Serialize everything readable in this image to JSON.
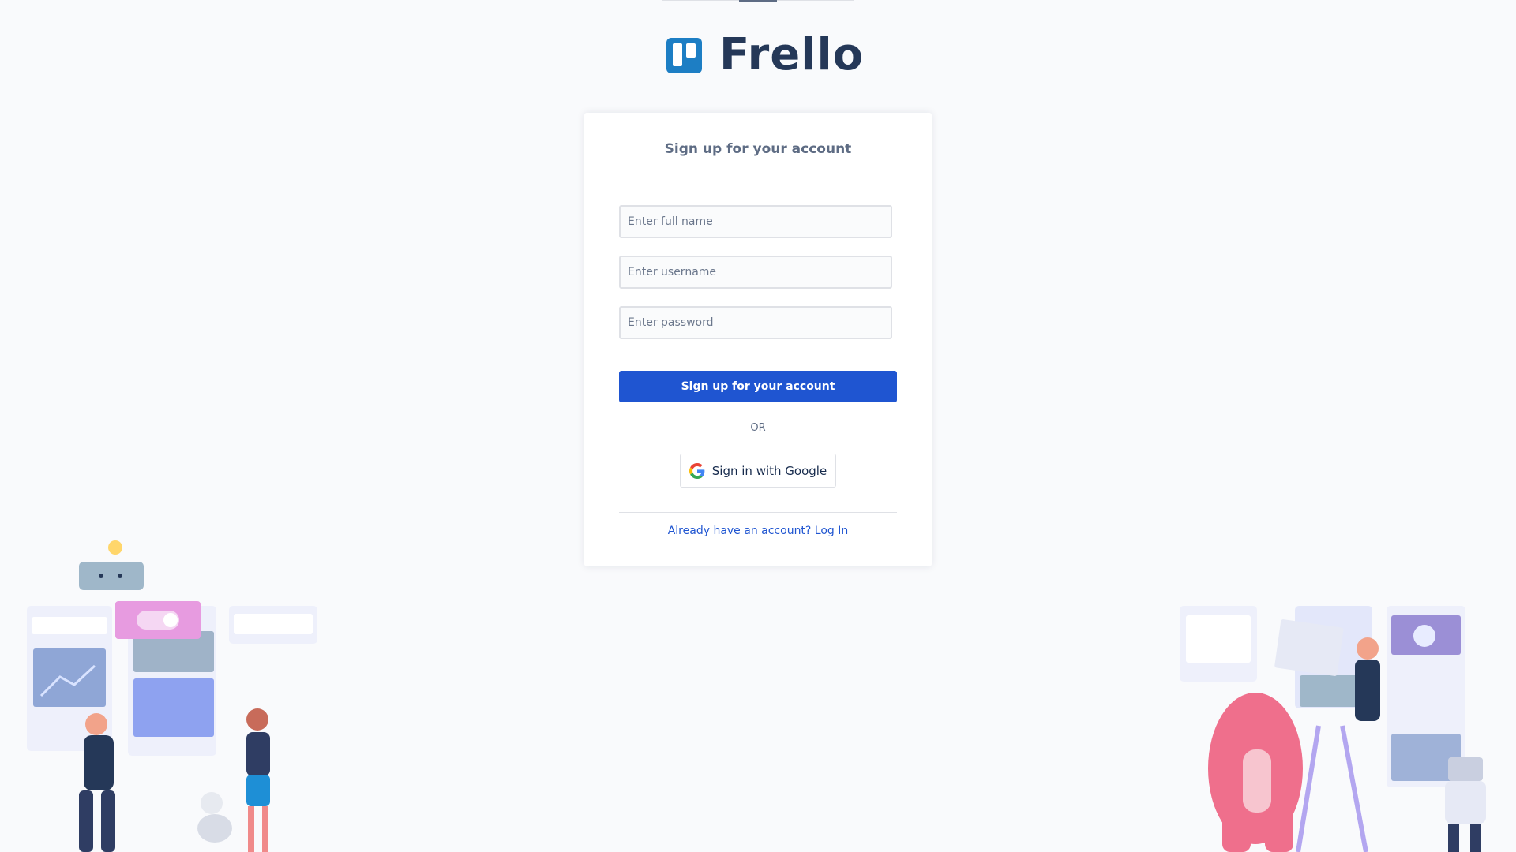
{
  "brand": {
    "name": "Frello",
    "logo_color": "#1d7ec4",
    "text_color": "#253858"
  },
  "form": {
    "title": "Sign up for your account",
    "fullname_placeholder": "Enter full name",
    "username_placeholder": "Enter username",
    "password_placeholder": "Enter password",
    "submit_label": "Sign up for your account",
    "or_label": "OR",
    "google_label": "Sign in with Google",
    "login_prompt": "Already have an account? Log In"
  },
  "colors": {
    "primary": "#1f55d1",
    "background": "#f9fafc",
    "muted": "#5e6c84"
  }
}
